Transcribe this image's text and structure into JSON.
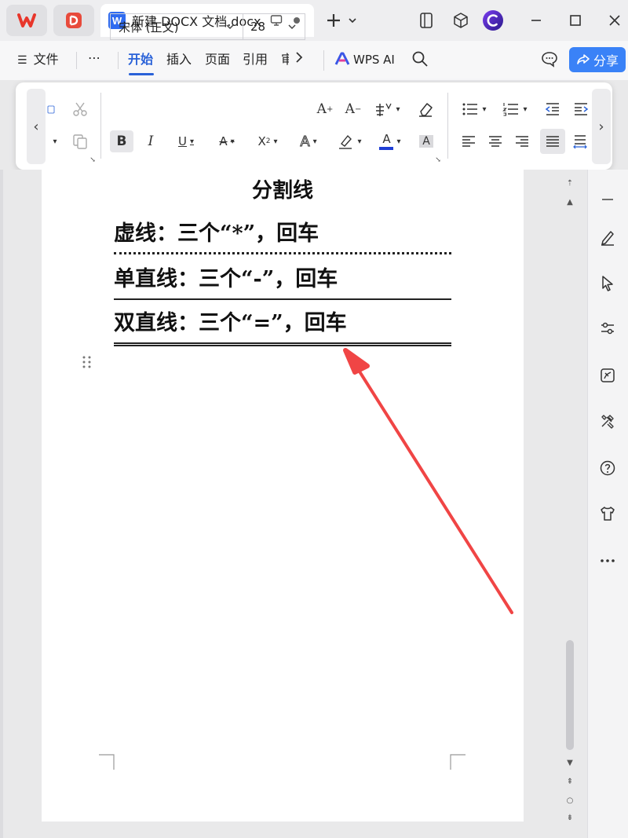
{
  "window": {
    "tab_title": "新建 DOCX 文档.docx",
    "tab_badge": "W"
  },
  "menu": {
    "file": "文件",
    "more": "⋯",
    "tabs": [
      "开始",
      "插入",
      "页面",
      "引用",
      "审"
    ],
    "active_tab": "开始",
    "wps_ai": "WPS AI",
    "share": "分享"
  },
  "toolbar": {
    "font_name": "宋体 (正文)",
    "font_size": "28"
  },
  "document": {
    "heading": "分割线",
    "lines": [
      "虚线：三个“*”，回车",
      "单直线：三个“-”，回车",
      "双直线：三个“=”，回车"
    ]
  },
  "colors": {
    "accent": "#2a62d8",
    "share_button": "#3a82f7",
    "arrow": "#f04545",
    "font_color_underline": "#1f3fd6"
  }
}
